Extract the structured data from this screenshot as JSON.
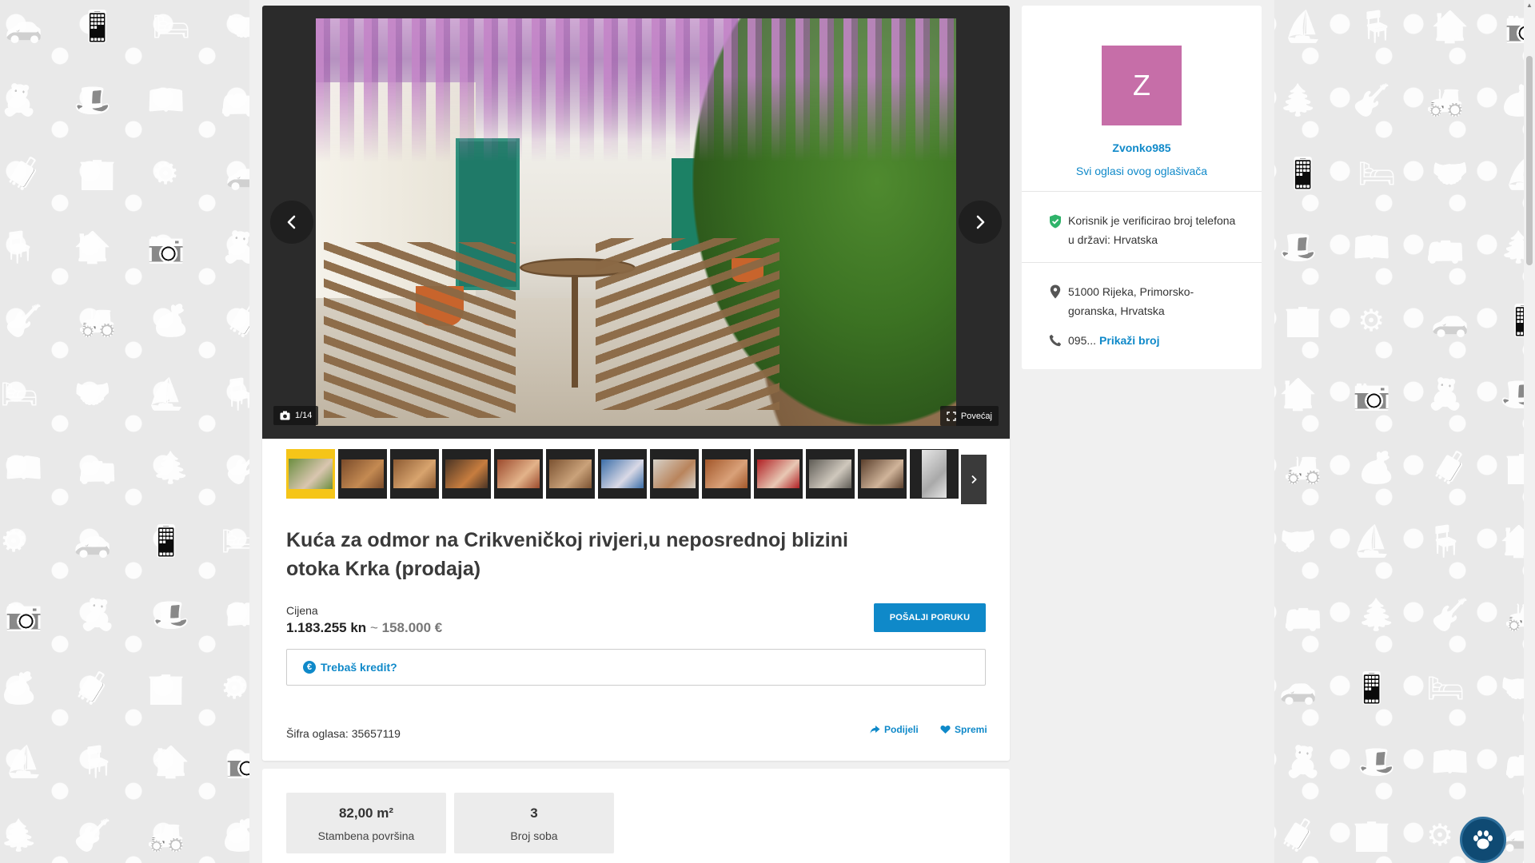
{
  "gallery": {
    "counter": "1/14",
    "enlarge_label": "Povećaj",
    "thumbnail_count": 13
  },
  "listing": {
    "title": "Kuća za odmor na Crikveničkoj rivjeri,u neposrednoj blizini otoka Krka (prodaja)",
    "price_label": "Cijena",
    "price_kn": "1.183.255 kn",
    "price_sep": "~",
    "price_eur": "158.000 €",
    "send_button": "POŠALJI PORUKU",
    "credit_label": "Trebaš kredit?",
    "credit_icon": "€",
    "ad_code": "Šifra oglasa: 35657119",
    "share_label": "Podijeli",
    "save_label": "Spremi"
  },
  "stats": [
    {
      "value": "82,00 m²",
      "label": "Stambena površina"
    },
    {
      "value": "3",
      "label": "Broj soba"
    }
  ],
  "seller": {
    "avatar_letter": "Z",
    "avatar_color": "#c66ea8",
    "name": "Zvonko985",
    "all_ads": "Svi oglasi ovog oglašivača",
    "verified_text": "Korisnik je verificirao broj telefona u državi: Hrvatska",
    "location": "51000 Rijeka, Primorsko-goranska, Hrvatska",
    "phone_prefix": "095...",
    "phone_show": "Prikaži broj"
  },
  "colors": {
    "accent": "#0f89c9",
    "verified": "#2fb36a"
  }
}
